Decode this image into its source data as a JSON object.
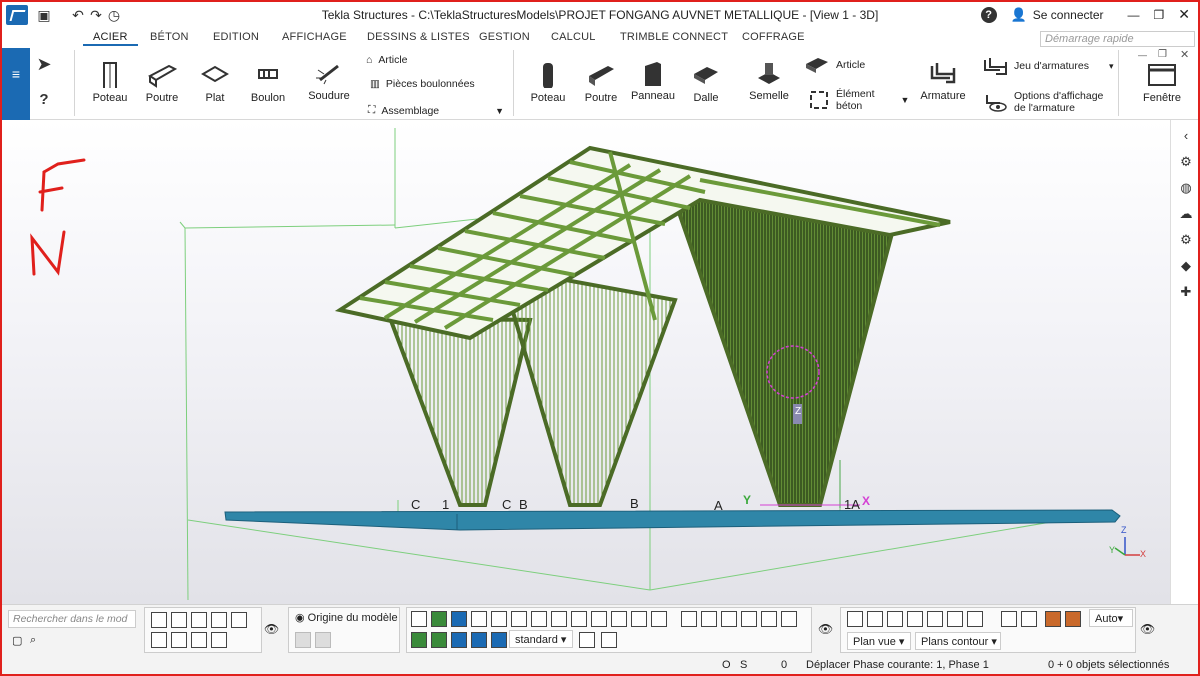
{
  "window": {
    "title": "Tekla Structures - C:\\TeklaStructuresModels\\PROJET FONGANG AUVNET METALLIQUE  - [View 1 - 3D]",
    "sign_in": "Se connecter",
    "help": "?"
  },
  "tabs": [
    "ACIER",
    "BÉTON",
    "EDITION",
    "AFFICHAGE",
    "DESSINS & LISTES",
    "GESTION",
    "CALCUL",
    "TRIMBLE CONNECT",
    "COFFRAGE"
  ],
  "quick_search": {
    "placeholder": "Démarrage rapide"
  },
  "ribbon": {
    "steel": {
      "poteau": "Poteau",
      "poutre": "Poutre",
      "plat": "Plat",
      "boulon": "Boulon",
      "soudure": "Soudure",
      "article": "Article",
      "pieces_boulonnees": "Pièces boulonnées",
      "assemblage": "Assemblage"
    },
    "concrete": {
      "poteau": "Poteau",
      "poutre": "Poutre",
      "panneau": "Panneau",
      "dalle": "Dalle",
      "semelle": "Semelle",
      "article": "Article",
      "element_beton": [
        "Élément",
        "béton"
      ],
      "armature": "Armature",
      "jeu_armatures": "Jeu d'armatures",
      "options_affichage": [
        "Options d'affichage",
        "de l'armature"
      ]
    },
    "fenetre": "Fenêtre"
  },
  "viewport": {
    "annotation": [
      "F",
      "N"
    ],
    "grid_labels": [
      {
        "text": "C",
        "label": "grid-label-c-left"
      },
      {
        "text": "1",
        "label": "grid-label-1-left"
      },
      {
        "text": "C",
        "label": "grid-label-c-mid"
      },
      {
        "text": "B",
        "label": "grid-label-b-mid"
      },
      {
        "text": "B",
        "label": "grid-label-b-right"
      },
      {
        "text": "A",
        "label": "grid-label-a"
      },
      {
        "text": "1A",
        "label": "grid-label-1a"
      }
    ],
    "axis_y": "Y",
    "axis_x": "X",
    "axis_z": "Z",
    "triad": {
      "z": "Z",
      "y": "Y",
      "x": "X"
    }
  },
  "bottom": {
    "search_placeholder": "Rechercher dans le mod",
    "origin": "Origine du modèle",
    "standard": "standard",
    "auto": "Auto",
    "plan_vue": "Plan vue",
    "plans_contour": "Plans contour"
  },
  "status": {
    "o": "O",
    "s": "S",
    "zero": "0",
    "phase": "Déplacer Phase courante: 1, Phase 1",
    "selected": "0 + 0 objets sélectionnés"
  },
  "colors": {
    "accent": "#1b6ab3",
    "steel_green": "#6b9a3a",
    "slab_blue": "#2f86a8",
    "frame_red": "#e0201c"
  }
}
